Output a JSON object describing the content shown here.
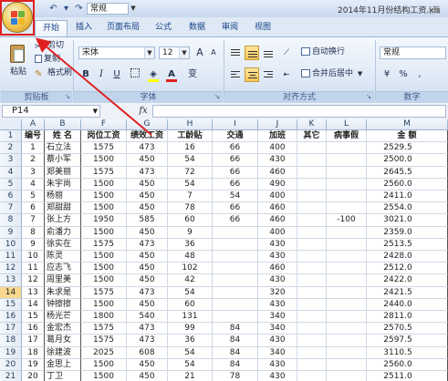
{
  "colors": {
    "accent": "#15428b",
    "annotation": "#e02020",
    "row_selected": "#f8d88e"
  },
  "titlebar": {
    "font_box": "常规",
    "window_title": "2014年11月份结构工资.xls",
    "window_title_suffix": "[兼"
  },
  "tabs": [
    "开始",
    "插入",
    "页面布局",
    "公式",
    "数据",
    "审阅",
    "视图"
  ],
  "active_tab": "开始",
  "ribbon": {
    "clipboard": {
      "label": "剪贴板",
      "paste": "粘贴",
      "cut": "剪切",
      "copy": "复制",
      "format_painter": "格式刷"
    },
    "font": {
      "label": "字体",
      "font_name": "宋体",
      "font_size": "12",
      "bold": "B",
      "italic": "I",
      "underline": "U",
      "grow": "A",
      "shrink": "A",
      "phonetic": "变"
    },
    "alignment": {
      "label": "对齐方式",
      "wrap_text": "自动换行",
      "merge_center": "合并后居中"
    },
    "number": {
      "label": "数字",
      "format": "常规"
    }
  },
  "formula_bar": {
    "name_box": "P14",
    "fx": "fx",
    "formula": ""
  },
  "sheet": {
    "column_headers": [
      "A",
      "B",
      "F",
      "G",
      "H",
      "I",
      "J",
      "K",
      "L",
      "M"
    ],
    "row_numbers": [
      "1",
      "2",
      "3",
      "4",
      "5",
      "6",
      "7",
      "8",
      "9",
      "10",
      "11",
      "12",
      "13",
      "14",
      "15",
      "16",
      "17",
      "18",
      "19",
      "20",
      "21"
    ],
    "selected_row": "14",
    "header_row": [
      "编号",
      "姓 名",
      "岗位工资",
      "绩效工资",
      "工龄贴",
      "交通",
      "加班",
      "其它",
      "病事假",
      "金 额"
    ],
    "rows": [
      [
        "1",
        "石立法",
        "1575",
        "473",
        "16",
        "66",
        "400",
        "",
        "",
        "2529.5"
      ],
      [
        "2",
        "蔡小军",
        "1500",
        "450",
        "54",
        "66",
        "430",
        "",
        "",
        "2500.0"
      ],
      [
        "3",
        "郑美丽",
        "1575",
        "473",
        "72",
        "66",
        "460",
        "",
        "",
        "2645.5"
      ],
      [
        "4",
        "朱宇尚",
        "1500",
        "450",
        "54",
        "66",
        "490",
        "",
        "",
        "2560.0"
      ],
      [
        "5",
        "杨丽",
        "1500",
        "450",
        "7",
        "54",
        "400",
        "",
        "",
        "2411.0"
      ],
      [
        "6",
        "郑甜甜",
        "1500",
        "450",
        "78",
        "66",
        "460",
        "",
        "",
        "2554.0"
      ],
      [
        "7",
        "张上方",
        "1950",
        "585",
        "60",
        "66",
        "460",
        "",
        "-100",
        "3021.0"
      ],
      [
        "8",
        "俞潘力",
        "1500",
        "450",
        "9",
        "",
        "400",
        "",
        "",
        "2359.0"
      ],
      [
        "9",
        "徐实在",
        "1575",
        "473",
        "36",
        "",
        "430",
        "",
        "",
        "2513.5"
      ],
      [
        "10",
        "陈灵",
        "1500",
        "450",
        "48",
        "",
        "430",
        "",
        "",
        "2428.0"
      ],
      [
        "11",
        "应志飞",
        "1500",
        "450",
        "102",
        "",
        "460",
        "",
        "",
        "2512.0"
      ],
      [
        "12",
        "周里美",
        "1500",
        "450",
        "42",
        "",
        "430",
        "",
        "",
        "2422.0"
      ],
      [
        "13",
        "朱求是",
        "1575",
        "473",
        "54",
        "",
        "320",
        "",
        "",
        "2421.5"
      ],
      [
        "14",
        "钟擦擦",
        "1500",
        "450",
        "60",
        "",
        "430",
        "",
        "",
        "2440.0"
      ],
      [
        "15",
        "杨光芒",
        "1800",
        "540",
        "131",
        "",
        "340",
        "",
        "",
        "2811.0"
      ],
      [
        "16",
        "金宏杰",
        "1575",
        "473",
        "99",
        "84",
        "340",
        "",
        "",
        "2570.5"
      ],
      [
        "17",
        "葛月女",
        "1575",
        "473",
        "36",
        "84",
        "430",
        "",
        "",
        "2597.5"
      ],
      [
        "18",
        "徐建波",
        "2025",
        "608",
        "54",
        "84",
        "340",
        "",
        "",
        "3110.5"
      ],
      [
        "19",
        "金思上",
        "1500",
        "450",
        "54",
        "84",
        "430",
        "",
        "",
        "2560.0"
      ],
      [
        "20",
        "丁卫",
        "1500",
        "450",
        "21",
        "78",
        "430",
        "",
        "",
        "2511.0"
      ]
    ]
  }
}
